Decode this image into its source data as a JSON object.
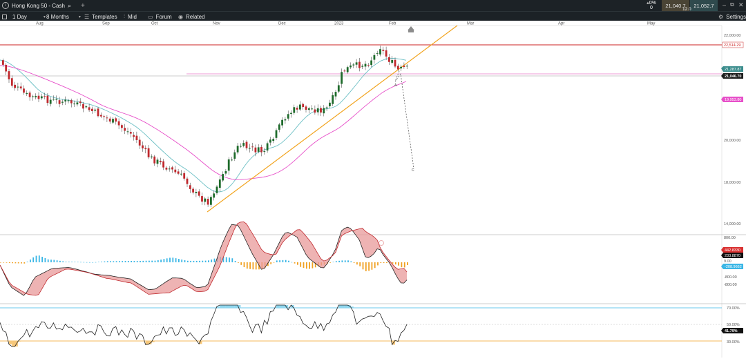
{
  "header": {
    "instrument": "Hong Kong 50 - Cash",
    "change_pct": "0%",
    "change_value": "0",
    "sell_price": "21,040.7",
    "buy_price": "21,052.7",
    "spread": "12.0"
  },
  "toolbar": {
    "interval": "1 Day",
    "range": "8 Months",
    "templates": "Templates",
    "price_type": "Mid",
    "forum": "Forum",
    "related": "Related",
    "settings": "Settings"
  },
  "months": [
    "Aug",
    "Sep",
    "Oct",
    "Nov",
    "Dec",
    "2023",
    "Feb",
    "Mar",
    "Apr",
    "May"
  ],
  "price_axis": {
    "ticks": [
      "22,000.00",
      "20,000.00",
      "18,000.00",
      "16,000.00",
      "14,000.00"
    ],
    "resistance_label": "22,514.29",
    "ma_fast_label": "21,287.87",
    "current_label": "21,046.70",
    "ma_slow_label": "19,953.80",
    "pattern_labels": [
      "A",
      "C"
    ]
  },
  "macd_axis": {
    "ticks": [
      "800.00",
      "9.00",
      "-800.00",
      "-800.00"
    ],
    "macd_label": "442.8330",
    "signal_label": "233.8870",
    "hist_label": "-208.9662"
  },
  "rsi_axis": {
    "ticks": [
      "70.00%",
      "50.00%",
      "30.00%"
    ],
    "current_label": "41.79%"
  },
  "colors": {
    "up": "#1e6b2b",
    "down": "#c0282d",
    "ma_fast": "#6bbfc4",
    "ma_slow": "#e74fc9",
    "trendline": "#f2a41f",
    "resistance": "#cc2222",
    "hist_pos": "#39b6e6",
    "hist_neg": "#f0a020"
  }
}
